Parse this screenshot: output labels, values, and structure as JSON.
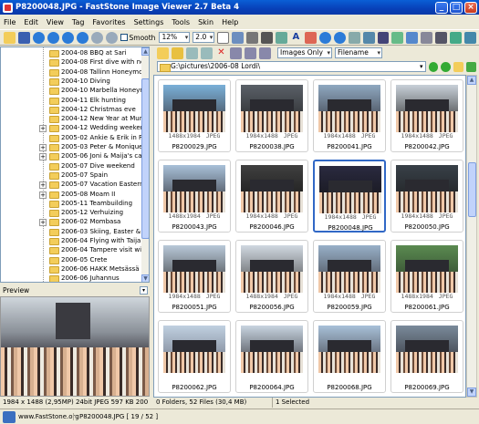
{
  "window": {
    "title": "P8200048.JPG  -  FastStone Image Viewer 2.7 Beta 4"
  },
  "menu": [
    "File",
    "Edit",
    "View",
    "Tag",
    "Favorites",
    "Settings",
    "Tools",
    "Skin",
    "Help"
  ],
  "toolbar": {
    "smooth_label": "Smooth",
    "zoom_value": "12%",
    "ratio_value": "2.0"
  },
  "filter": {
    "type_value": "Images Only",
    "sort_value": "Filename"
  },
  "path": {
    "value": "G:\\pictures\\2006-08 Lordi\\"
  },
  "tree": [
    {
      "label": "2004-08 BBQ at Sari",
      "expand": false
    },
    {
      "label": "2004-08 First dive with new ge",
      "expand": false
    },
    {
      "label": "2004-08 Tallinn Honeymoon pa",
      "expand": false
    },
    {
      "label": "2004-10 Diving",
      "expand": false
    },
    {
      "label": "2004-10 Marbella Honeymoon p",
      "expand": false
    },
    {
      "label": "2004-11 Elk hunting",
      "expand": false
    },
    {
      "label": "2004-12 Christmas eve",
      "expand": false
    },
    {
      "label": "2004-12 New Year at Mummo",
      "expand": false
    },
    {
      "label": "2004-12 Wedding weekend",
      "expand": true
    },
    {
      "label": "2005-02 Ankie & Erik in Finland",
      "expand": false
    },
    {
      "label": "2005-03 Peter & Monique in Fir",
      "expand": true
    },
    {
      "label": "2005-06 Joni & Maija's cabin",
      "expand": true
    },
    {
      "label": "2005-07 Dive weekend",
      "expand": false
    },
    {
      "label": "2005-07 Spain",
      "expand": false
    },
    {
      "label": "2005-07 Vacation Eastern Finla",
      "expand": true
    },
    {
      "label": "2005-08 Moam II",
      "expand": true
    },
    {
      "label": "2005-11 Teambuilding",
      "expand": false
    },
    {
      "label": "2005-12 Verhuizing",
      "expand": false
    },
    {
      "label": "2006-02 Mombasa",
      "expand": true
    },
    {
      "label": "2006-03 Skiing, Easter & Gradu",
      "expand": false
    },
    {
      "label": "2006-04 Flying with Taija and T",
      "expand": false
    },
    {
      "label": "2006-04 Tampere visit with HAI",
      "expand": false
    },
    {
      "label": "2006-05 Crete",
      "expand": false
    },
    {
      "label": "2006-06 HAKK Metsässä",
      "expand": false
    },
    {
      "label": "2006-06 Juhannus",
      "expand": false
    }
  ],
  "preview": {
    "header": "Preview",
    "status": "1984 x 1488 (2,95MP)  24bit JPEG  597 KB  200"
  },
  "thumbnails": [
    {
      "dims": "1488x1984",
      "ext": "JPEG",
      "name": "P8200029.JPG"
    },
    {
      "dims": "1984x1488",
      "ext": "JPEG",
      "name": "P8200038.JPG"
    },
    {
      "dims": "1984x1488",
      "ext": "JPEG",
      "name": "P8200041.JPG"
    },
    {
      "dims": "1984x1488",
      "ext": "JPEG",
      "name": "P8200042.JPG"
    },
    {
      "dims": "1488x1984",
      "ext": "JPEG",
      "name": "P8200043.JPG"
    },
    {
      "dims": "1984x1488",
      "ext": "JPEG",
      "name": "P8200046.JPG"
    },
    {
      "dims": "1984x1488",
      "ext": "JPEG",
      "name": "P8200048.JPG"
    },
    {
      "dims": "1984x1488",
      "ext": "JPEG",
      "name": "P8200050.JPG"
    },
    {
      "dims": "1984x1488",
      "ext": "JPEG",
      "name": "P8200051.JPG"
    },
    {
      "dims": "1488x1984",
      "ext": "JPEG",
      "name": "P8200056.JPG"
    },
    {
      "dims": "1984x1488",
      "ext": "JPEG",
      "name": "P8200059.JPG"
    },
    {
      "dims": "1488x1984",
      "ext": "JPEG",
      "name": "P8200061.JPG"
    },
    {
      "dims": "",
      "ext": "",
      "name": "P8200062.JPG"
    },
    {
      "dims": "",
      "ext": "",
      "name": "P8200064.JPG"
    },
    {
      "dims": "",
      "ext": "",
      "name": "P8200068.JPG"
    },
    {
      "dims": "",
      "ext": "",
      "name": "P8200069.JPG"
    }
  ],
  "selected_index": 6,
  "status": {
    "folders": "0 Folders, 52 Files (30,4 MB)",
    "selected": "1 Selected"
  },
  "bottom": {
    "site": "www.FastStone.org",
    "file": "P8200048.JPG [ 19 / 52 ]"
  },
  "colors": {
    "title": "#0a46c0",
    "selection": "#3168c6",
    "folder": "#f3cd5a"
  }
}
